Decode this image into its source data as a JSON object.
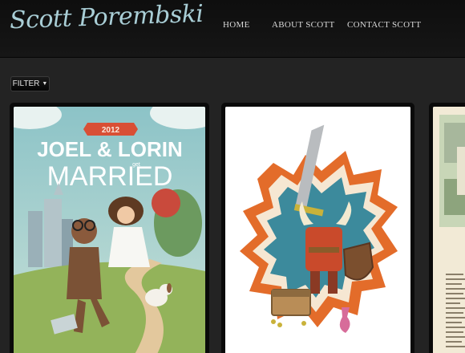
{
  "header": {
    "logo_text": "Scott Porembski",
    "nav": [
      {
        "label": "HOME"
      },
      {
        "label": "ABOUT SCOTT"
      },
      {
        "label": "CONTACT SCOTT"
      }
    ]
  },
  "filter": {
    "label": "FILTER"
  },
  "poster1": {
    "badge": "2012",
    "line1": "JOEL & LORIN",
    "get": "get",
    "line2": "MARRIED"
  },
  "card3": {
    "text": "Why sing\nresearch\nthrough\njust wo\nworks of\nfriends th\nworld\nwants all\nfreight w\nFrom th\nMoscow\nPeele\nfeet!\nthe\ncom\nbeg\nbelong\nlower"
  }
}
